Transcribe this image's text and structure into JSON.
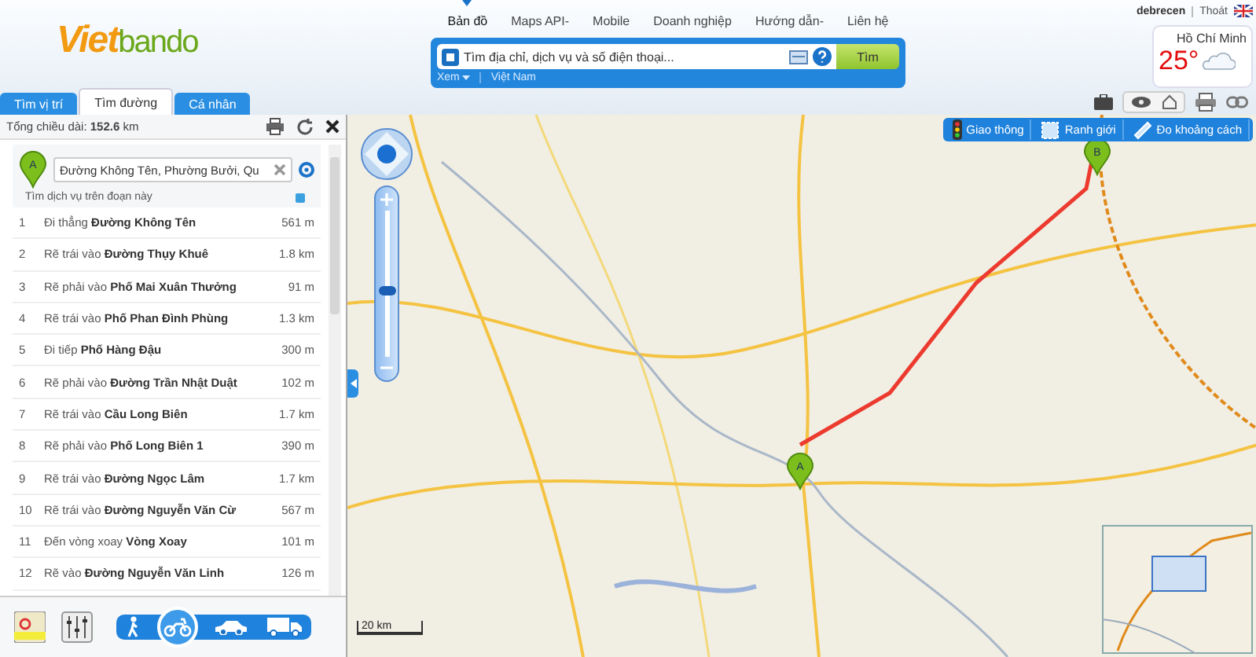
{
  "header": {
    "logo": {
      "first": "Viet",
      "second": "bando"
    },
    "nav": [
      {
        "label": "Bản đồ",
        "selected": true
      },
      {
        "label": "Maps API",
        "caret": "-",
        "selected": false
      },
      {
        "label": "Mobile",
        "selected": false
      },
      {
        "label": "Doanh nghiệp",
        "selected": false
      },
      {
        "label": "Hướng dẫn",
        "caret": "-",
        "selected": false
      },
      {
        "label": "Liên hệ",
        "selected": false
      }
    ],
    "user": {
      "name": "debrecen",
      "logout": "Thoát"
    },
    "weather": {
      "city": "Hồ Chí Minh",
      "temp": "25°"
    }
  },
  "search": {
    "placeholder": "Tìm địa chỉ, dịch vụ và số điện thoại...",
    "button": "Tìm",
    "scope": "Xem",
    "region": "Việt Nam"
  },
  "tabs": [
    {
      "label": "Tìm vị trí",
      "selected": false
    },
    {
      "label": "Tìm đường",
      "selected": true
    },
    {
      "label": "Cá nhân",
      "selected": false
    }
  ],
  "route_panel": {
    "total": "Tổng chiều dài: **152.6** km",
    "start_marker": "A",
    "start_value": "Đường Không Tên, Phường Bưởi, Qu",
    "service_link": "Tìm dịch vụ trên đoạn này",
    "steps": [
      {
        "num": "1",
        "text": "Đi thẳng **Đường Không Tên**",
        "distance": "561 m"
      },
      {
        "num": "2",
        "text": "Rẽ trái vào **Đường Thụy Khuê**",
        "distance": "1.8 km"
      },
      {
        "num": "3",
        "text": "Rẽ phải vào **Phố Mai Xuân Thưởng**",
        "distance": "91 m"
      },
      {
        "num": "4",
        "text": "Rẽ trái vào **Phố Phan Đình Phùng**",
        "distance": "1.3 km"
      },
      {
        "num": "5",
        "text": "Đi tiếp **Phố Hàng Đậu**",
        "distance": "300 m"
      },
      {
        "num": "6",
        "text": "Rẽ phải vào **Đường Trần Nhật Duật**",
        "distance": "102 m"
      },
      {
        "num": "7",
        "text": "Rẽ trái vào **Cầu Long Biên**",
        "distance": "1.7 km"
      },
      {
        "num": "8",
        "text": "Rẽ phải vào **Phố Long Biên 1**",
        "distance": "390 m"
      },
      {
        "num": "9",
        "text": "Rẽ trái vào **Đường Ngọc Lâm**",
        "distance": "1.7 km"
      },
      {
        "num": "10",
        "text": "Rẽ trái vào **Đường Nguyễn Văn Cừ**",
        "distance": "567 m"
      },
      {
        "num": "11",
        "text": "Đến vòng xoay **Vòng Xoay**",
        "distance": "101 m"
      },
      {
        "num": "12",
        "text": "Rẽ vào **Đường Nguyễn Văn Linh**",
        "distance": "126 m"
      }
    ],
    "transport_modes": [
      {
        "kind": "walk",
        "selected": false
      },
      {
        "kind": "motorbike",
        "selected": true
      },
      {
        "kind": "car",
        "selected": false
      },
      {
        "kind": "truck",
        "selected": false
      }
    ]
  },
  "map": {
    "tools": [
      {
        "kind": "traffic",
        "label": "Giao thông"
      },
      {
        "kind": "boundary",
        "label": "Ranh giới"
      },
      {
        "kind": "measure",
        "label": "Đo khoảng cách"
      }
    ],
    "marker_start": "A",
    "marker_end": "B",
    "scale": "20 km",
    "zoom": {
      "level": 0.45
    }
  }
}
